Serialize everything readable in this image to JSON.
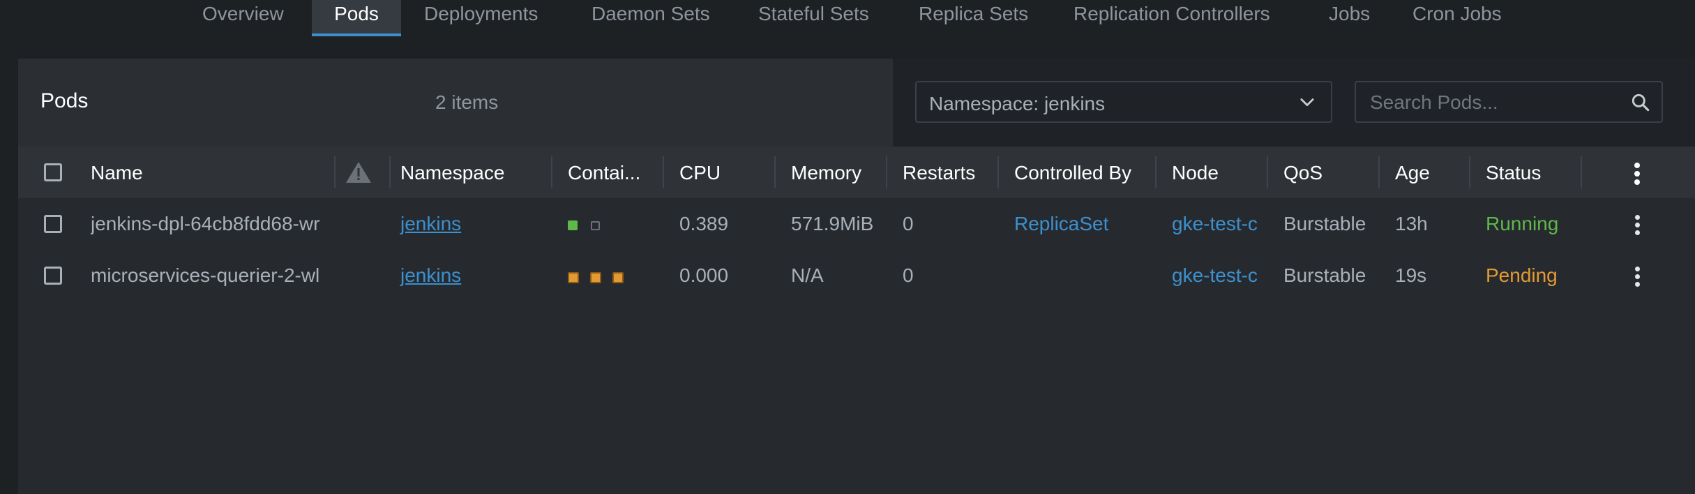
{
  "tabs": [
    {
      "label": "Overview"
    },
    {
      "label": "Pods"
    },
    {
      "label": "Deployments"
    },
    {
      "label": "Daemon Sets"
    },
    {
      "label": "Stateful Sets"
    },
    {
      "label": "Replica Sets"
    },
    {
      "label": "Replication Controllers"
    },
    {
      "label": "Jobs"
    },
    {
      "label": "Cron Jobs"
    }
  ],
  "active_tab": "Pods",
  "header": {
    "title": "Pods",
    "items_count": "2 items",
    "namespace_select": "Namespace: jenkins",
    "search_placeholder": "Search Pods..."
  },
  "table": {
    "columns": [
      "Name",
      "Namespace",
      "Contai...",
      "CPU",
      "Memory",
      "Restarts",
      "Controlled By",
      "Node",
      "QoS",
      "Age",
      "Status"
    ],
    "rows": [
      {
        "name": "jenkins-dpl-64cb8fdd68-wr",
        "namespace": "jenkins",
        "containers": [
          "running",
          "empty"
        ],
        "cpu": "0.389",
        "memory": "571.9MiB",
        "restarts": "0",
        "controlled_by": "ReplicaSet",
        "node": "gke-test-c",
        "qos": "Burstable",
        "age": "13h",
        "status": "Running"
      },
      {
        "name": "microservices-querier-2-wl",
        "namespace": "jenkins",
        "containers": [
          "pending",
          "pending",
          "pending"
        ],
        "cpu": "0.000",
        "memory": "N/A",
        "restarts": "0",
        "controlled_by": "",
        "node": "gke-test-c",
        "qos": "Burstable",
        "age": "19s",
        "status": "Pending"
      }
    ]
  },
  "colors": {
    "accent": "#3d90ce",
    "running": "#5fb84a",
    "pending": "#e39a32",
    "warning_icon": "#6c7178"
  },
  "icons": {
    "namespace_select": "chevron-down-icon",
    "search": "search-icon",
    "warnings_column": "warning-icon",
    "menu": "kebab-menu-icon"
  }
}
